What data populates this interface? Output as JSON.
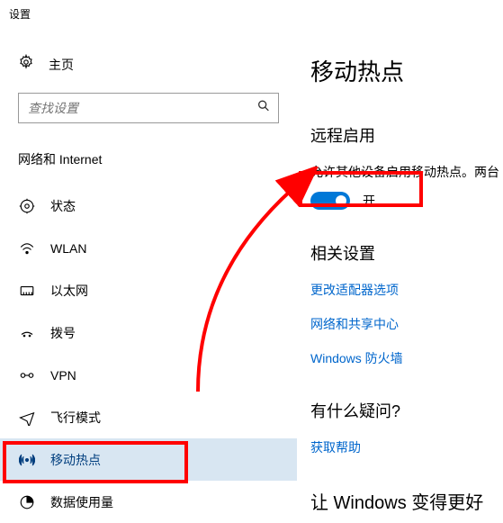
{
  "window": {
    "title": "设置"
  },
  "sidebar": {
    "home": "主页",
    "search_placeholder": "查找设置",
    "category": "网络和 Internet",
    "items": [
      {
        "label": "状态"
      },
      {
        "label": "WLAN"
      },
      {
        "label": "以太网"
      },
      {
        "label": "拨号"
      },
      {
        "label": "VPN"
      },
      {
        "label": "飞行模式"
      },
      {
        "label": "移动热点"
      },
      {
        "label": "数据使用量"
      }
    ]
  },
  "content": {
    "page_title": "移动热点",
    "remote_section": {
      "header": "远程启用",
      "desc": "允许其他设备启用移动热点。两台",
      "toggle_label": "开"
    },
    "related_section": {
      "header": "相关设置",
      "links": [
        "更改适配器选项",
        "网络和共享中心",
        "Windows 防火墙"
      ]
    },
    "help_section": {
      "header": "有什么疑问?",
      "link": "获取帮助"
    },
    "improve_section": {
      "header": "让 Windows 变得更好"
    }
  }
}
